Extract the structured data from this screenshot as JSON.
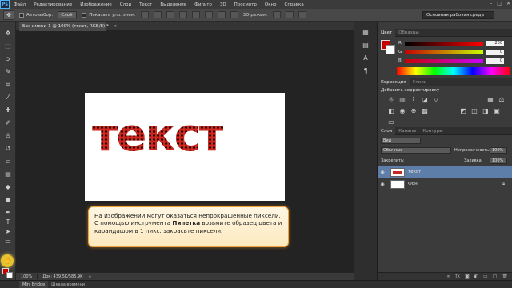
{
  "app": {
    "logo": "Ps"
  },
  "menu": [
    "Файл",
    "Редактирование",
    "Изображение",
    "Слои",
    "Текст",
    "Выделение",
    "Фильтр",
    "3D",
    "Просмотр",
    "Окно",
    "Справка"
  ],
  "window_controls": [
    "–",
    "□",
    "✕"
  ],
  "options_bar": {
    "autoselect_label": "Автовыбор:",
    "autoselect_value": "Слой",
    "show_controls_label": "Показать упр. элем.",
    "mode_3d_label": "3D-режим:",
    "workspace": "Основная рабочая среда"
  },
  "document_tab": {
    "title": "Без имени-1 @ 100% (текст, RGB/8) *",
    "close": "×"
  },
  "canvas": {
    "text": "текст",
    "fill_color": "#d2261e",
    "dot_color": "#1a0a08"
  },
  "callout": {
    "part1": "На изображении могут оказаться непрокрашенные пиксели. С помощью инструмента ",
    "bold": "Пипетка",
    "part2": " возьмите образец цвета и карандашом в 1 пикс. закрасьте пиксели."
  },
  "status": {
    "zoom": "100%",
    "doc_info": "Док: 439,5K/585,9K"
  },
  "bottom_tabs": [
    "Mini Bridge",
    "Шкала времени"
  ],
  "color_panel": {
    "tabs": [
      "Цвет",
      "Образцы"
    ],
    "channels": [
      {
        "label": "R",
        "value": "200"
      },
      {
        "label": "G",
        "value": "0"
      },
      {
        "label": "B",
        "value": "0"
      }
    ],
    "foreground": "#c80000",
    "background": "#ffffff"
  },
  "adjustments_panel": {
    "tabs": [
      "Коррекция",
      "Стили"
    ],
    "title": "Добавить корректировку"
  },
  "layers_panel": {
    "tabs": [
      "Слои",
      "Каналы",
      "Контуры"
    ],
    "kind_filter": "Вид",
    "blend_mode": "Обычные",
    "opacity_label": "Непрозрачность:",
    "opacity_value": "100%",
    "lock_label": "Закрепить:",
    "fill_label": "Заливка:",
    "fill_value": "100%",
    "layers": [
      {
        "name": "текст",
        "selected": true
      },
      {
        "name": "Фон",
        "selected": false
      }
    ]
  },
  "icons": {
    "tools": [
      "move-icon",
      "marquee-icon",
      "lasso-icon",
      "quick-select-icon",
      "crop-icon",
      "eyedropper-icon",
      "healing-icon",
      "brush-icon",
      "clone-stamp-icon",
      "history-brush-icon",
      "eraser-icon",
      "gradient-icon",
      "blur-icon",
      "dodge-icon",
      "pen-icon",
      "type-icon",
      "path-select-icon",
      "rectangle-icon",
      "hand-icon",
      "zoom-icon"
    ]
  }
}
